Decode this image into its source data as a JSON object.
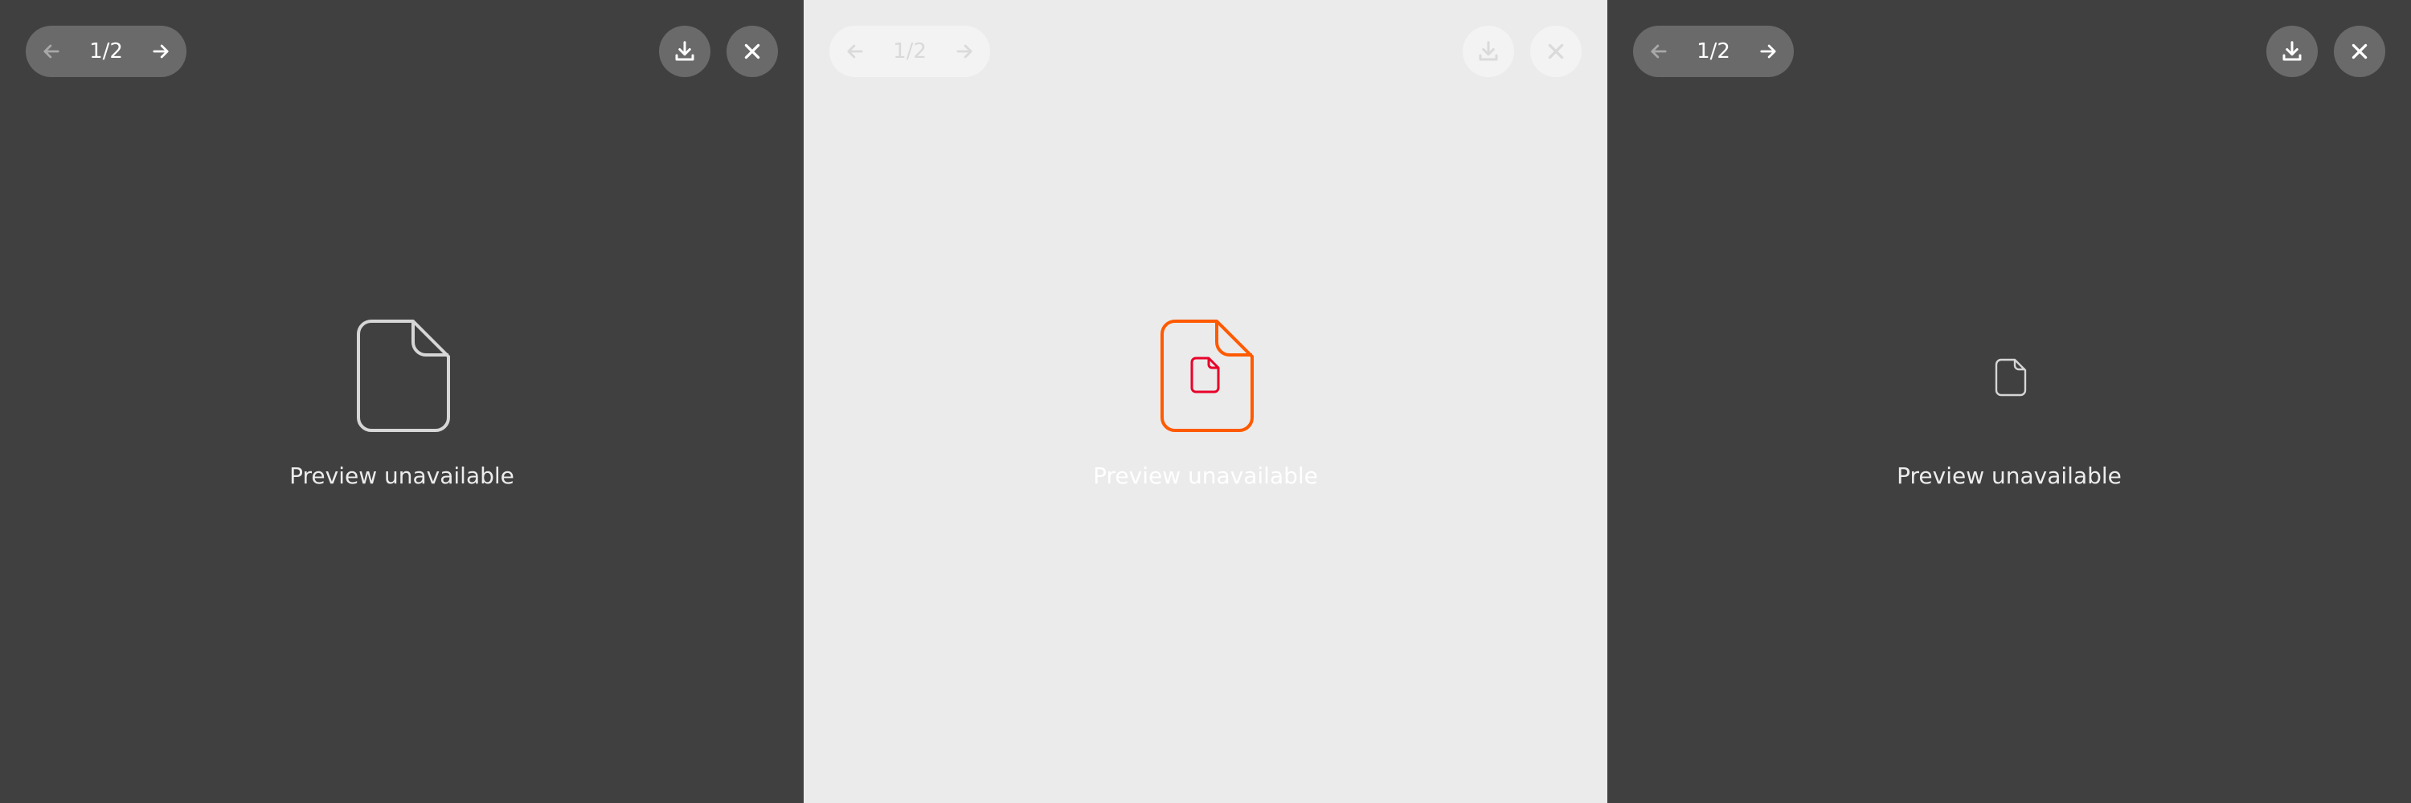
{
  "viewers": [
    {
      "theme": "dark",
      "pager": {
        "count": "1/2"
      },
      "icons": [
        "arrow-left-icon",
        "arrow-right-icon",
        "download-icon",
        "close-icon",
        "file-icon"
      ],
      "message": "Preview unavailable"
    },
    {
      "theme": "light",
      "pager": {
        "count": "1/2"
      },
      "icons": [
        "arrow-left-icon",
        "arrow-right-icon",
        "download-icon",
        "close-icon",
        "file-icon"
      ],
      "message": "Preview unavailable",
      "file_icon_colors": {
        "outer": "#ff5a00",
        "inner": "#e8002a"
      }
    },
    {
      "theme": "dark",
      "pager": {
        "count": "1/2"
      },
      "icons": [
        "arrow-left-icon",
        "arrow-right-icon",
        "download-icon",
        "close-icon",
        "file-icon"
      ],
      "message": "Preview unavailable"
    }
  ]
}
